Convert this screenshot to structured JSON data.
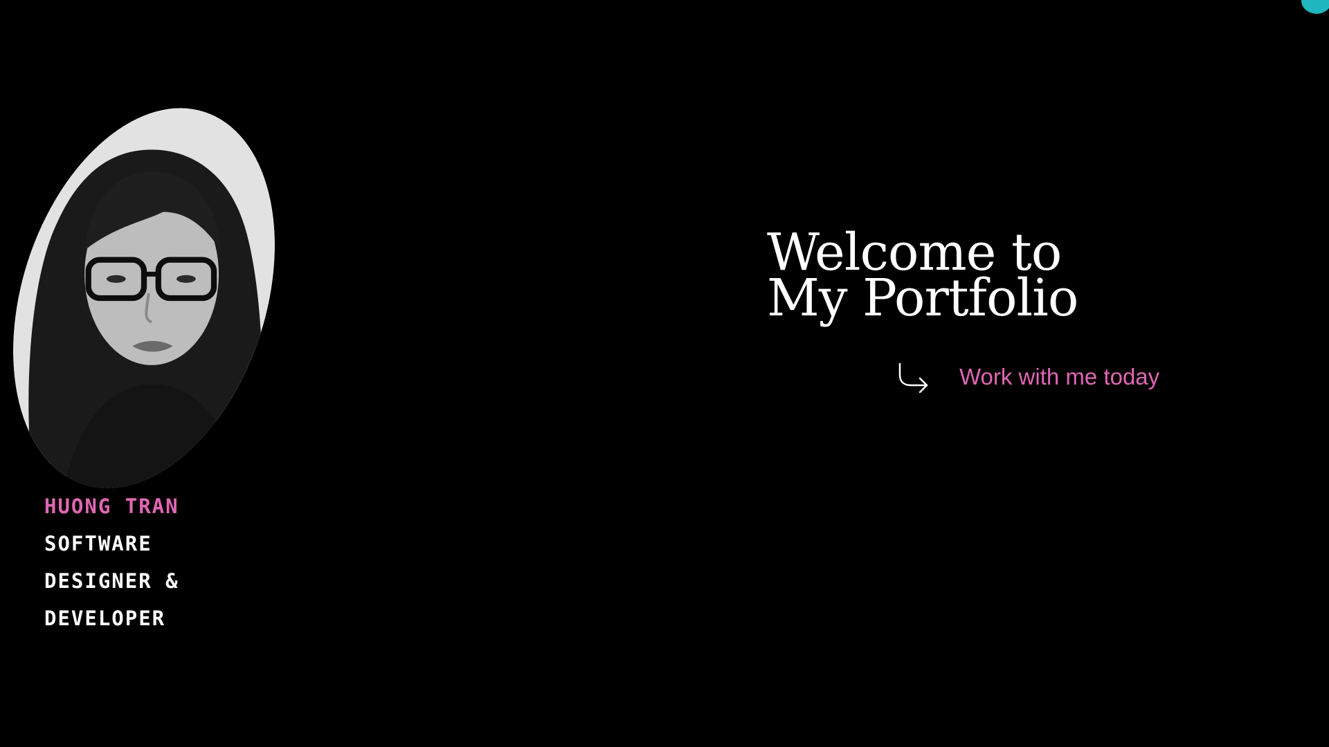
{
  "profile": {
    "name": "Huong Tran",
    "role": "Software Designer & Developer",
    "photo_icon": "portrait-photo"
  },
  "hero": {
    "title_line1": "Welcome to",
    "title_line2": "My Portfolio"
  },
  "cta": {
    "label": "Work with me today",
    "icon": "curved-arrow-right-icon"
  },
  "colors": {
    "background": "#000000",
    "accent_pink": "#e066b3",
    "text_white": "#ffffff",
    "dot_teal": "#1fb6c0"
  }
}
